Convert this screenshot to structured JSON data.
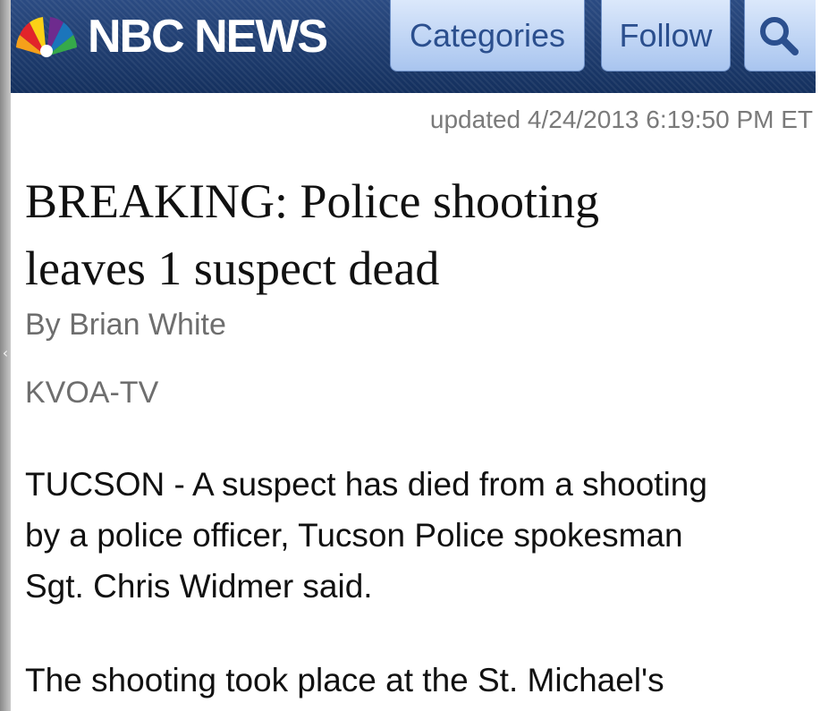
{
  "header": {
    "logo_text": "NBC NEWS",
    "logo_icon": "nbc-peacock-icon",
    "categories_label": "Categories",
    "follow_label": "Follow",
    "search_icon": "search-icon"
  },
  "article": {
    "updated": "updated 4/24/2013 6:19:50 PM ET",
    "headline_line1": "BREAKING: Police shooting",
    "headline_line2": "leaves 1 suspect dead",
    "byline": "By Brian White",
    "source": "KVOA-TV",
    "paragraph1_line1": "TUCSON - A suspect has died from a shooting",
    "paragraph1_line2": "by a police officer, Tucson Police spokesman",
    "paragraph1_line3": "Sgt. Chris Widmer said.",
    "paragraph2_line1": "The shooting took place at the St. Michael's"
  },
  "colors": {
    "header_bg": "#1f3a6b",
    "nav_button_bg": "#bcd3f5",
    "nav_button_text": "#2b4f8e",
    "muted_text": "#6e6e6e"
  }
}
